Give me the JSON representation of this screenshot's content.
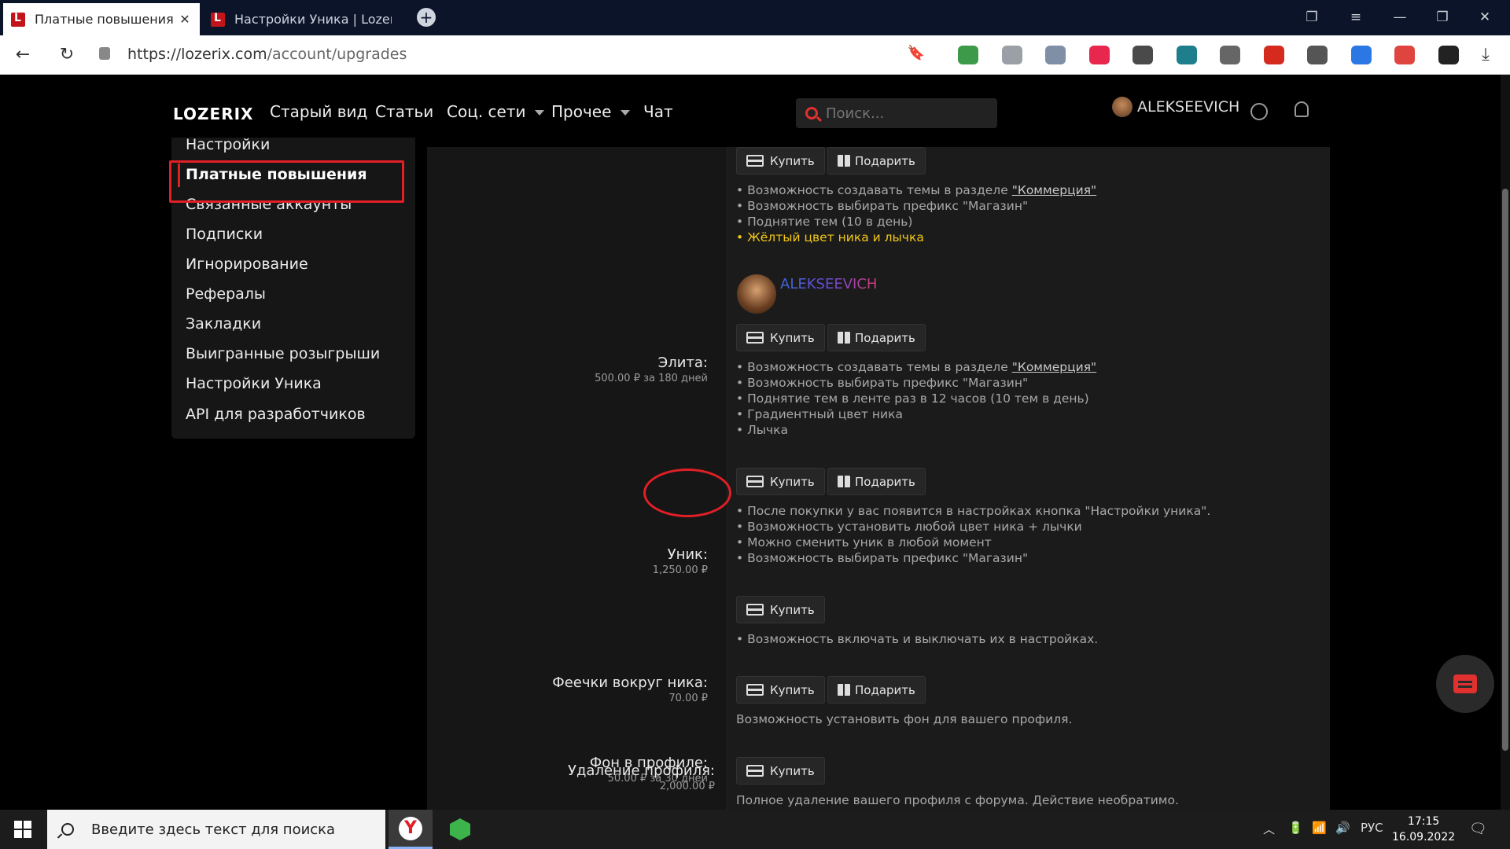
{
  "browser": {
    "tabs": [
      {
        "title": "Платные повышения | L",
        "active": true
      },
      {
        "title": "Настройки Уника | Lozerix",
        "active": false
      }
    ],
    "close_glyph": "✕",
    "new_tab_glyph": "+",
    "url_host": "https://lozerix.com",
    "url_path": "/account/upgrades",
    "back_glyph": "←",
    "reload_glyph": "↻",
    "bookmark_glyph": "🔖",
    "download_glyph": "⤓",
    "window_glyphs": {
      "collections": "❐",
      "menu": "≡",
      "minimize": "—",
      "restore": "❐",
      "close": "✕"
    },
    "extensions": [
      {
        "icon": "shield-green-icon",
        "color": "#3c9a48"
      },
      {
        "icon": "mouse-icon",
        "color": "#9aa0a6"
      },
      {
        "icon": "privacy-shield-icon",
        "color": "#7f8fa6"
      },
      {
        "icon": "vk-icon",
        "color": "#e8274f"
      },
      {
        "icon": "sync-icon",
        "color": "#4a4a4a"
      },
      {
        "icon": "robot-icon",
        "color": "#1e7e8c"
      },
      {
        "icon": "ip-icon",
        "color": "#666666"
      },
      {
        "icon": "flag-ru-icon",
        "color": "#d52b1e"
      },
      {
        "icon": "incognito-icon",
        "color": "#555555"
      },
      {
        "icon": "calendar-icon",
        "color": "#2b78e4"
      },
      {
        "icon": "block-icon",
        "color": "#e0443e"
      },
      {
        "icon": "battery-icon",
        "color": "#222222"
      }
    ]
  },
  "site": {
    "logo": "LOZERIX",
    "nav": [
      {
        "label": "Старый вид",
        "dropdown": false
      },
      {
        "label": "Статьи",
        "dropdown": false
      },
      {
        "label": "Соц. сети",
        "dropdown": true
      },
      {
        "label": "Прочее",
        "dropdown": true
      },
      {
        "label": "Чат",
        "dropdown": false
      }
    ],
    "search_placeholder": "Поиск...",
    "username": "ALEKSEEVICH"
  },
  "sidebar": {
    "items": [
      {
        "label": "Настройки",
        "active": false
      },
      {
        "label": "Платные повышения",
        "active": true
      },
      {
        "label": "Связанные аккаунты",
        "active": false
      },
      {
        "label": "Подписки",
        "active": false
      },
      {
        "label": "Игнорирование",
        "active": false
      },
      {
        "label": "Рефералы",
        "active": false
      },
      {
        "label": "Закладки",
        "active": false
      },
      {
        "label": "Выигранные розыгрыши",
        "active": false
      },
      {
        "label": "Настройки Уника",
        "active": false
      },
      {
        "label": "API для разработчиков",
        "active": false
      }
    ]
  },
  "buttons": {
    "buy": "Купить",
    "gift": "Подарить"
  },
  "upgrades": {
    "top": {
      "features": [
        {
          "text": "• Возможность создавать темы в разделе ",
          "link": "\"Коммерция\""
        },
        {
          "text": "• Возможность выбирать префикс \"Магазин\""
        },
        {
          "text": "• Поднятие тем (10 в день)"
        },
        {
          "text": "• Жёлтый цвет ника и лычка"
        }
      ]
    },
    "elite": {
      "name": "Элита:",
      "price": "500.00 ₽ за 180 дней",
      "nick": "ALEKSEEVICH",
      "features": [
        {
          "text": "• Возможность создавать темы в разделе ",
          "link": "\"Коммерция\""
        },
        {
          "text": "• Возможность выбирать префикс \"Магазин\""
        },
        {
          "text": "• Поднятие тем в ленте раз в 12 часов (10 тем в день)"
        },
        {
          "text": "• Градиентный цвет ника"
        },
        {
          "text": "• Лычка"
        }
      ]
    },
    "unik": {
      "name": "Уник:",
      "price": "1,250.00 ₽",
      "features": [
        "• После покупки у вас появится в настройках кнопка \"Настройки уника\".",
        "• Возможность установить любой цвет ника + лычки",
        "• Можно сменить уник в любой момент",
        "• Возможность выбирать префикс \"Магазин\""
      ]
    },
    "sparkles": {
      "name": "Феечки вокруг ника:",
      "price": "70.00 ₽",
      "features": [
        "• Возможность включать и выключать их в настройках."
      ]
    },
    "background": {
      "name": "Фон в профиле:",
      "price": "50.00 ₽ за 30 дней",
      "features": [
        "Возможность установить фон для вашего профиля."
      ]
    },
    "delete": {
      "name": "Удаление профиля:",
      "price": "2,000.00 ₽",
      "features": [
        "Полное удаление вашего профиля с форума. Действие необратимо."
      ]
    }
  },
  "taskbar": {
    "search_placeholder": "Введите здесь текст для поиска",
    "yandex_glyph": "Y",
    "tray_up": "︿",
    "tray_volume": "🔊",
    "tray_wifi": "📶",
    "tray_battery": "🔋",
    "notification_glyph": "🗨",
    "lang": "РУС",
    "time": "17:15",
    "date": "16.09.2022"
  },
  "colors": {
    "accent_red": "#e0312f",
    "highlight_yellow": "#f2c818",
    "annotation_red": "#e01f26"
  }
}
